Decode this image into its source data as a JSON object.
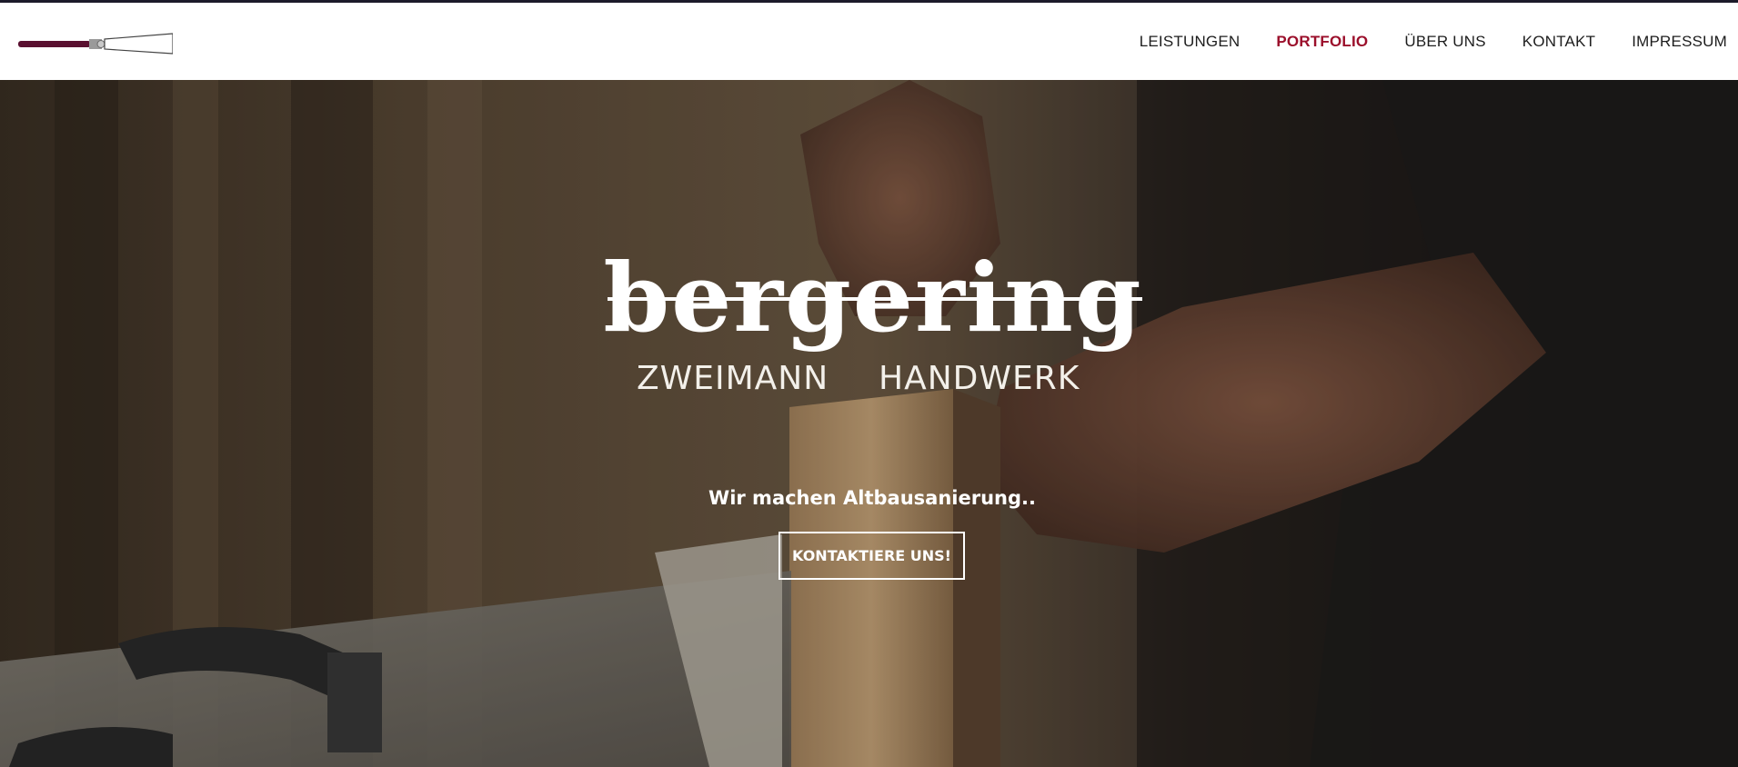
{
  "header": {
    "logo_icon": "chisel-logo-icon",
    "nav": {
      "services": "LEISTUNGEN",
      "portfolio": "PORTFOLIO",
      "about": "ÜBER UNS",
      "contact": "KONTAKT",
      "imprint": "IMPRESSUM"
    },
    "active_nav": "PORTFOLIO"
  },
  "hero": {
    "brand_name": "bergering",
    "tagline_left": "ZWEIMANN",
    "tagline_right": "HANDWERK",
    "subtitle": "Wir machen Altbausanierung..",
    "cta_label": "KONTAKTIERE UNS!"
  },
  "colors": {
    "accent": "#9b0f2b",
    "nav_text": "#1d1d1d",
    "logo_handle": "#5a1030",
    "hero_text": "#ffffff"
  }
}
